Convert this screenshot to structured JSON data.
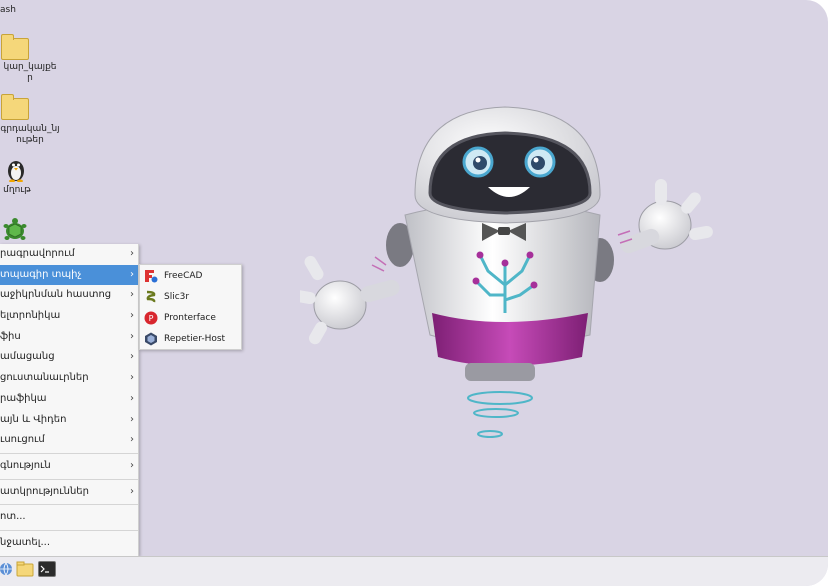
{
  "desktop": {
    "top_partial_label": "ash",
    "icons": [
      {
        "label_line1": "կար_կայքե",
        "label_line2": "ր",
        "icon": "folder-icon"
      },
      {
        "label_line1": "գրդական_նյ",
        "label_line2": "ութեր",
        "icon": "folder-icon"
      },
      {
        "label_line1": "մղութ",
        "label_line2": "",
        "icon": "penguin-icon"
      },
      {
        "label_line1": "",
        "label_line2": "",
        "icon": "turtle-icon"
      }
    ]
  },
  "menu": {
    "items": [
      {
        "label": "րագրավորում",
        "arrow": "›"
      },
      {
        "label": "տպագիր տպիչ",
        "arrow": "›",
        "active": true
      },
      {
        "label": "աջիկրնման հաստոց",
        "arrow": "›"
      },
      {
        "label": "ելտրոնիկա",
        "arrow": "›"
      },
      {
        "label": "ֆիս",
        "arrow": "›"
      },
      {
        "label": "ամացանց",
        "arrow": "›"
      },
      {
        "label": "ցուստանաւրներ",
        "arrow": "›"
      },
      {
        "label": "րաֆիկա",
        "arrow": "›"
      },
      {
        "label": "այն և Վիդեո",
        "arrow": "›"
      },
      {
        "label": "ւսուցում",
        "arrow": "›"
      },
      {
        "label": "գնություն",
        "arrow": "›"
      },
      {
        "label": "ատկրություններ",
        "arrow": "›"
      },
      {
        "label": "ոտ...",
        "arrow": ""
      },
      {
        "label": "նջատել...",
        "arrow": ""
      }
    ]
  },
  "submenu": {
    "items": [
      {
        "label": "FreeCAD",
        "icon": "freecad-icon"
      },
      {
        "label": "Slic3r",
        "icon": "slic3r-icon"
      },
      {
        "label": "Pronterface",
        "icon": "pronterface-icon"
      },
      {
        "label": "Repetier-Host",
        "icon": "repetier-icon"
      }
    ]
  },
  "colors": {
    "desktop_bg": "#d9d4e4",
    "menu_highlight": "#4a90d9",
    "robot_accent": "#a6309a"
  }
}
